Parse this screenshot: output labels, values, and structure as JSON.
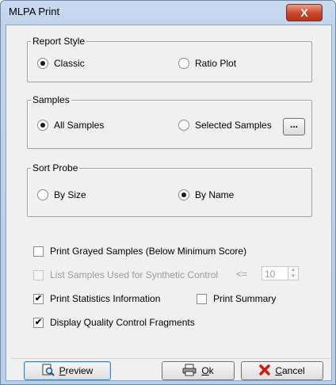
{
  "window": {
    "title": "MLPA Print",
    "close_glyph": "X"
  },
  "report_style": {
    "legend": "Report Style",
    "options": [
      {
        "label": "Classic",
        "selected": true
      },
      {
        "label": "Ratio Plot",
        "selected": false
      }
    ]
  },
  "samples": {
    "legend": "Samples",
    "options": [
      {
        "label": "All Samples",
        "selected": true
      },
      {
        "label": "Selected Samples",
        "selected": false
      }
    ],
    "browse_label": "..."
  },
  "sort_probe": {
    "legend": "Sort Probe",
    "options": [
      {
        "label": "By Size",
        "selected": false
      },
      {
        "label": "By Name",
        "selected": true
      }
    ]
  },
  "checks": {
    "grayed": {
      "label": "Print Grayed Samples (Below Minimum Score)",
      "checked": false
    },
    "synthetic": {
      "label": "List Samples Used for Synthetic Control",
      "checked": false,
      "enabled": false
    },
    "synthetic_op": "<=",
    "synthetic_value": "10",
    "statistics": {
      "label": "Print Statistics Information",
      "checked": true
    },
    "summary": {
      "label": "Print Summary",
      "checked": false
    },
    "qc": {
      "label": "Display Quality Control Fragments",
      "checked": true
    }
  },
  "buttons": {
    "preview": "Preview",
    "ok": "Ok",
    "cancel": "Cancel"
  },
  "check_glyph": "✔",
  "icons": {
    "preview": "magnifier-page-icon",
    "ok": "printer-icon",
    "cancel": "red-x-icon"
  },
  "colors": {
    "cancel_x": "#cc1b0f",
    "title_bg": "#c9dbef"
  }
}
